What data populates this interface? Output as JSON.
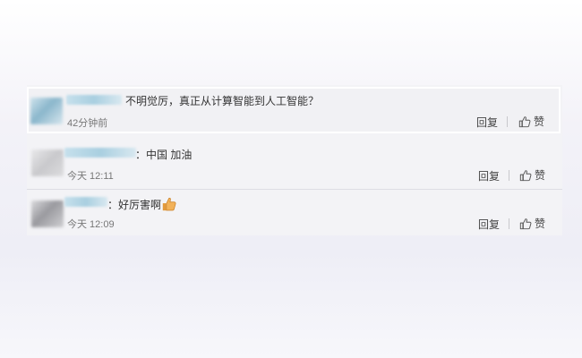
{
  "comments": [
    {
      "text": "不明觉厉，真正从计算智能到人工智能？",
      "time": "42分钟前",
      "reply_label": "回复",
      "like_label": "赞",
      "avatar_icon": "blurred-avatar-icon"
    },
    {
      "text": "：中国 加油",
      "time": "今天 12:11",
      "reply_label": "回复",
      "like_label": "赞",
      "avatar_icon": "blurred-avatar-icon"
    },
    {
      "text": "：好厉害啊",
      "time": "今天 12:09",
      "reply_label": "回复",
      "like_label": "赞",
      "avatar_icon": "blurred-avatar-icon",
      "emoji_icon": "thumbs-up-emoji-icon"
    }
  ],
  "colors": {
    "accent_blur": "#a9cfe0",
    "panel_bg": "#f3f3f6"
  }
}
